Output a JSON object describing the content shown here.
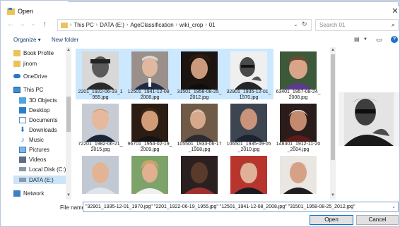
{
  "window": {
    "title": "Open"
  },
  "path": {
    "crumbs": [
      "This PC",
      "DATA (E:)",
      "AgeClassification",
      "wiki_crop",
      "01"
    ]
  },
  "search": {
    "placeholder": "Search 01"
  },
  "toolbar": {
    "organize": "Organize ▾",
    "new_folder": "New folder"
  },
  "sidebar": {
    "items": [
      {
        "label": "Book Profile",
        "icon": "folder-icon"
      },
      {
        "label": "jinom",
        "icon": "folder-icon"
      },
      {
        "label": "OneDrive",
        "icon": "onedrive-icon"
      },
      {
        "label": "This PC",
        "icon": "computer-icon"
      },
      {
        "label": "3D Objects",
        "icon": "3d-objects-icon"
      },
      {
        "label": "Desktop",
        "icon": "desktop-icon"
      },
      {
        "label": "Documents",
        "icon": "documents-icon"
      },
      {
        "label": "Downloads",
        "icon": "downloads-icon"
      },
      {
        "label": "Music",
        "icon": "music-icon"
      },
      {
        "label": "Pictures",
        "icon": "pictures-icon"
      },
      {
        "label": "Videos",
        "icon": "videos-icon"
      },
      {
        "label": "Local Disk (C:)",
        "icon": "drive-icon"
      },
      {
        "label": "DATA (E:)",
        "icon": "drive-icon"
      },
      {
        "label": "Network",
        "icon": "network-icon"
      }
    ]
  },
  "files": [
    {
      "name": "2201_1922-06-19_1955.jpg",
      "selected": true
    },
    {
      "name": "12501_1941-12-08_2008.jpg",
      "selected": true
    },
    {
      "name": "31501_1958-08-25_2012.jpg",
      "selected": true
    },
    {
      "name": "32901_1935-12-01_1970.jpg",
      "selected": true
    },
    {
      "name": "63401_1957-08-24_2008.jpg",
      "selected": false
    },
    {
      "name": "72201_1982-06-21_2015.jpg",
      "selected": false
    },
    {
      "name": "96701_1954-02-19_2009.jpg",
      "selected": false
    },
    {
      "name": "105501_1933-06-17_1998.jpg",
      "selected": false
    },
    {
      "name": "106501_1935-09-05_2010.jpg",
      "selected": false
    },
    {
      "name": "148301_1912-11-20_2004.jpg",
      "selected": false
    },
    {
      "name": "",
      "selected": false
    },
    {
      "name": "",
      "selected": false
    },
    {
      "name": "",
      "selected": false
    },
    {
      "name": "",
      "selected": false
    },
    {
      "name": "",
      "selected": false
    }
  ],
  "filename": {
    "label": "File name:",
    "value": "\"32901_1935-12-01_1970.jpg\" \"2201_1922-06-19_1955.jpg\" \"12501_1941-12-08_2008.jpg\" \"31501_1958-08-25_2012.jpg\""
  },
  "buttons": {
    "open": "Open",
    "cancel": "Cancel"
  },
  "colors": {
    "selection": "#cce8ff",
    "accent": "#0078d7"
  }
}
